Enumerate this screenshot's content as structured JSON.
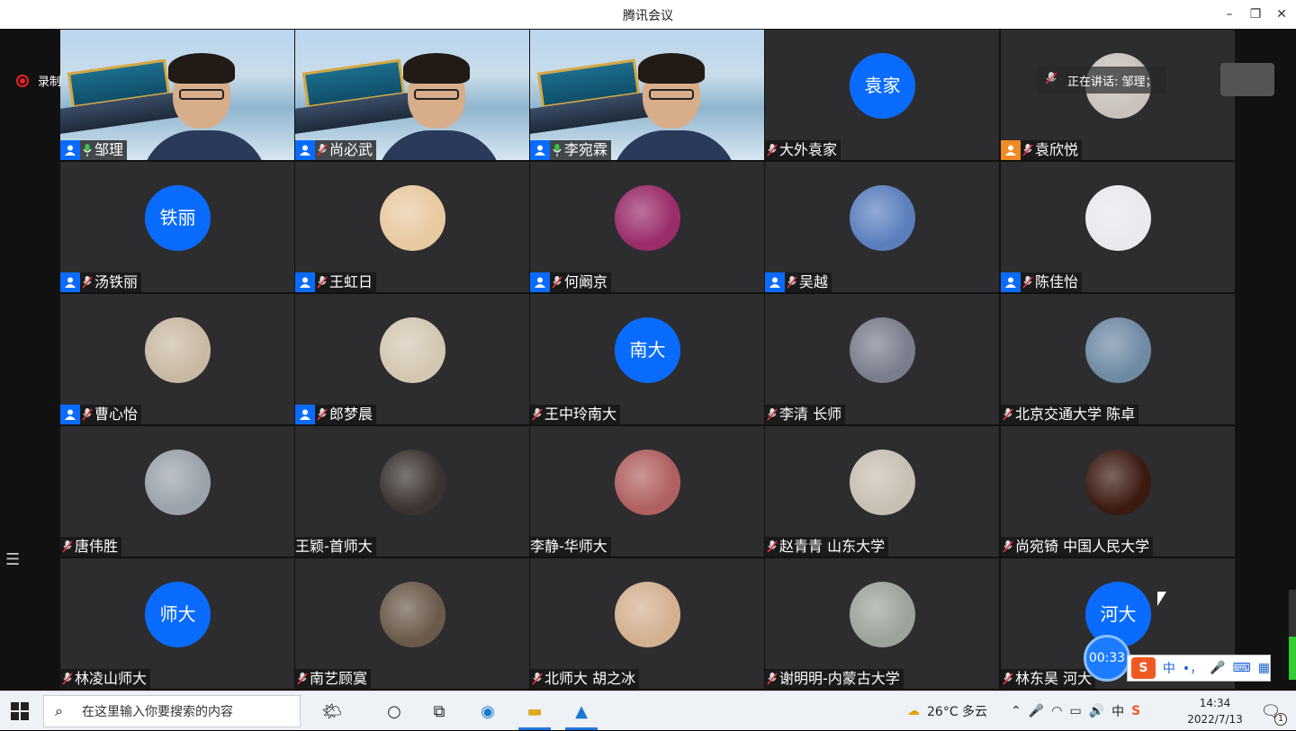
{
  "window": {
    "title": "腾讯会议"
  },
  "recording": {
    "label": "录制中"
  },
  "speaking": {
    "label": "正在讲话: 邹理；"
  },
  "timer": "00:33",
  "participants": [
    {
      "name": "邹理",
      "type": "video",
      "badge": "blue",
      "mic": "on",
      "speaking": true
    },
    {
      "name": "尚必武",
      "type": "video",
      "badge": "blue",
      "mic": "muted"
    },
    {
      "name": "李宛霖",
      "type": "video",
      "badge": "blue",
      "mic": "on"
    },
    {
      "name": "大外袁家",
      "type": "text",
      "avatar": "袁家",
      "badge": "none",
      "mic": "muted"
    },
    {
      "name": "袁欣悦",
      "type": "photo",
      "badge": "orange",
      "mic": "muted",
      "color": "#c9c2bb"
    },
    {
      "name": "汤铁丽",
      "type": "text",
      "avatar": "铁丽",
      "badge": "blue",
      "mic": "muted"
    },
    {
      "name": "王虹日",
      "type": "photo",
      "badge": "blue",
      "mic": "muted",
      "color": "#e8c9a0"
    },
    {
      "name": "何阚京",
      "type": "photo",
      "badge": "blue",
      "mic": "muted",
      "color": "#9a2c6a"
    },
    {
      "name": "吴越",
      "type": "photo",
      "badge": "blue",
      "mic": "muted",
      "color": "#5a7fbd"
    },
    {
      "name": "陈佳怡",
      "type": "photo",
      "badge": "blue",
      "mic": "muted",
      "color": "#e9e9ee"
    },
    {
      "name": "曹心怡",
      "type": "photo",
      "badge": "blue",
      "mic": "muted",
      "color": "#c9b9a4"
    },
    {
      "name": "郎梦晨",
      "type": "photo",
      "badge": "blue",
      "mic": "muted",
      "color": "#d4c7b2"
    },
    {
      "name": "王中玲南大",
      "type": "text",
      "avatar": "南大",
      "badge": "none",
      "mic": "muted"
    },
    {
      "name": "李清 长师",
      "type": "photo",
      "badge": "none",
      "mic": "muted",
      "color": "#7a7d8c"
    },
    {
      "name": "北京交通大学 陈卓",
      "type": "photo",
      "badge": "none",
      "mic": "muted",
      "color": "#6f8aa3"
    },
    {
      "name": "唐伟胜",
      "type": "photo",
      "badge": "none",
      "mic": "muted",
      "color": "#9aa3ab"
    },
    {
      "name": "王颖-首师大",
      "type": "photo",
      "badge": "none",
      "mic": "none",
      "color": "#3b3330"
    },
    {
      "name": "李静-华师大",
      "type": "photo",
      "badge": "none",
      "mic": "none",
      "color": "#b06060"
    },
    {
      "name": "赵青青 山东大学",
      "type": "photo",
      "badge": "none",
      "mic": "muted",
      "color": "#c7bfb2"
    },
    {
      "name": "尚宛锜 中国人民大学",
      "type": "photo",
      "badge": "none",
      "mic": "muted",
      "color": "#3b1a10"
    },
    {
      "name": "林凌山师大",
      "type": "text",
      "avatar": "师大",
      "badge": "none",
      "mic": "muted"
    },
    {
      "name": "南艺顾寞",
      "type": "photo",
      "badge": "none",
      "mic": "muted",
      "color": "#6b5a4a"
    },
    {
      "name": "北师大 胡之冰",
      "type": "photo",
      "badge": "none",
      "mic": "muted",
      "color": "#d4b090"
    },
    {
      "name": "谢明明-内蒙古大学",
      "type": "photo",
      "badge": "none",
      "mic": "muted",
      "color": "#9ca39a"
    },
    {
      "name": "林东昊 河大",
      "type": "text",
      "avatar": "河大",
      "badge": "none",
      "mic": "muted"
    }
  ],
  "ime": {
    "mode": "中",
    "punct": "•，"
  },
  "taskbar": {
    "search_placeholder": "在这里输入你要搜索的内容",
    "weather": "26°C 多云",
    "ime": "中",
    "time": "14:34",
    "date": "2022/7/13",
    "notifications": "1"
  }
}
